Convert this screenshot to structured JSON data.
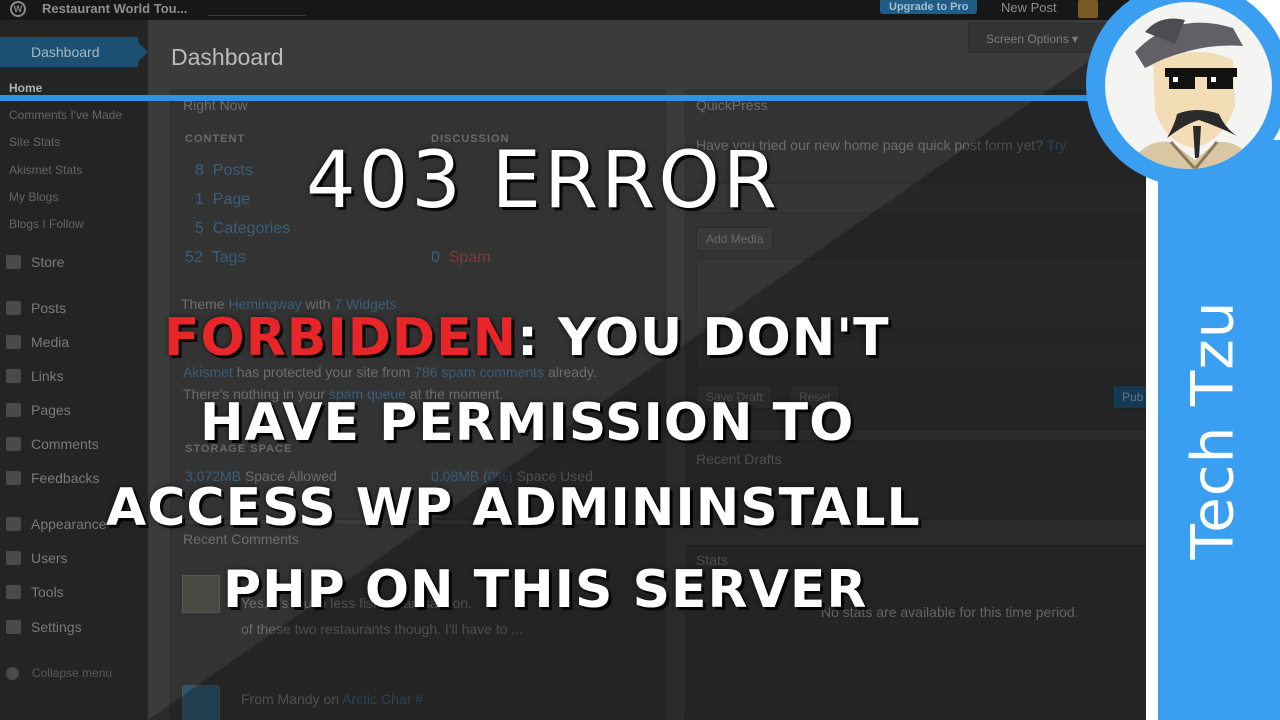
{
  "adminbar": {
    "site_name": "Restaurant World Tou...",
    "upgrade_label": "Upgrade to Pro",
    "new_post_label": "New Post"
  },
  "sidebar": {
    "dashboard_label": "Dashboard",
    "sub_items": [
      "Home",
      "Comments I've Made",
      "Site Stats",
      "Akismet Stats",
      "My Blogs",
      "Blogs I Follow"
    ],
    "menu_items": [
      "Store",
      "Posts",
      "Media",
      "Links",
      "Pages",
      "Comments",
      "Feedbacks",
      "Appearance",
      "Users",
      "Tools",
      "Settings"
    ],
    "collapse_label": "Collapse menu"
  },
  "content": {
    "page_title": "Dashboard",
    "screen_options_label": "Screen Options",
    "right_now": {
      "title": "Right Now",
      "content_header": "CONTENT",
      "discussion_header": "DISCUSSION",
      "content_counts": [
        {
          "num": "8",
          "label": "Posts"
        },
        {
          "num": "1",
          "label": "Page"
        },
        {
          "num": "5",
          "label": "Categories"
        },
        {
          "num": "52",
          "label": "Tags"
        }
      ],
      "discussion_counts": [
        {
          "num": "0",
          "label": "Spam"
        }
      ],
      "theme_prefix": "Theme",
      "theme_name": "Hemingway",
      "theme_with": "with",
      "widgets_label": "7 Widgets",
      "akismet_link": "Akismet",
      "akismet_text_a": "has protected your site from",
      "akismet_spam_link": "786 spam comments",
      "akismet_text_b": "already.",
      "spam_queue_a": "There's nothing in your",
      "spam_queue_link": "spam queue",
      "spam_queue_b": "at the moment.",
      "storage_header": "STORAGE SPACE",
      "storage_allowed": "3,072MB",
      "storage_allowed_label": "Space Allowed",
      "storage_used": "0.08MB (0%)",
      "storage_used_label": "Space Used"
    },
    "recent_comments": {
      "title": "Recent Comments",
      "item1_text_a": "Yes, it's much less fishy than salmon. ",
      "item1_text_b": "of these two restaurants though. I'll have to ...",
      "item2_from": "From Mandy on",
      "item2_link": "Arctic Char #"
    },
    "quickpress": {
      "title": "QuickPress",
      "intro": "Have you tried our new home page quick post form yet?",
      "intro_link": "Try",
      "add_media": "Add Media",
      "save_draft": "Save Draft",
      "reset": "Reset",
      "publish": "Pub",
      "recent_drafts": "Recent Drafts",
      "stats_title": "Stats",
      "stats_text": "No stats are available for this time period."
    }
  },
  "overlay": {
    "error_title": "403 ERROR",
    "forbidden_word": "FORBIDDEN",
    "line1_rest": ": YOU DON'T",
    "line2": "HAVE PERMISSION TO",
    "line3": "ACCESS WP ADMININSTALL",
    "line4": "PHP ON THIS SERVER"
  },
  "brand": {
    "name": "Tech Tzu",
    "portrait_icon": "sage-portrait-with-pixel-sunglasses-icon"
  },
  "colors": {
    "rule_blue": "#2d93e6",
    "brand_blue": "#3b9ff1",
    "forbidden_red": "#e8262a",
    "overlay_text": "#ffffff"
  }
}
